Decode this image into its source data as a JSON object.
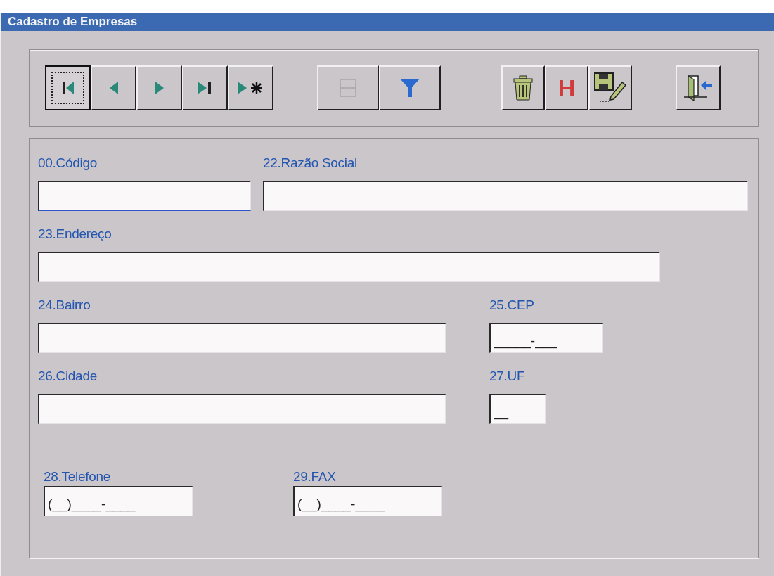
{
  "window": {
    "title": "Cadastro de Empresas"
  },
  "toolbar": [
    [
      {
        "kind": "first",
        "focused": true,
        "disabled": false
      },
      {
        "kind": "prev",
        "focused": false,
        "disabled": false
      },
      {
        "kind": "next",
        "focused": false,
        "disabled": false
      },
      {
        "kind": "last",
        "focused": false,
        "disabled": false
      },
      {
        "kind": "new",
        "focused": false,
        "disabled": false
      }
    ],
    [
      {
        "kind": "grid",
        "focused": false,
        "disabled": true
      },
      {
        "kind": "filter",
        "focused": false,
        "disabled": false
      }
    ],
    [
      {
        "kind": "delete",
        "focused": false,
        "disabled": false
      },
      {
        "kind": "glyph",
        "glyph": "H",
        "focused": false,
        "disabled": false
      },
      {
        "kind": "save-edit",
        "focused": false,
        "disabled": false
      }
    ],
    [
      {
        "kind": "exit",
        "focused": false,
        "disabled": false
      }
    ]
  ],
  "form": {
    "rows": [
      [
        {
          "label": "00.Código",
          "focused": true
        },
        {
          "label": "22.Razão Social",
          "focused": false
        }
      ],
      [
        {
          "label": "23.Endereço",
          "focused": false
        }
      ],
      [
        {
          "label": "24.Bairro",
          "focused": false
        },
        {
          "label": "25.CEP",
          "value": "_____-___",
          "focused": false
        }
      ],
      [
        {
          "label": "26.Cidade",
          "focused": false
        },
        {
          "label": "27.UF",
          "value": "__",
          "focused": false
        }
      ],
      [
        {
          "label": "28.Telefone",
          "value": "(__)____-____",
          "focused": false
        },
        {
          "label": "29.FAX",
          "value": "(__)____-____",
          "focused": false
        }
      ]
    ]
  }
}
